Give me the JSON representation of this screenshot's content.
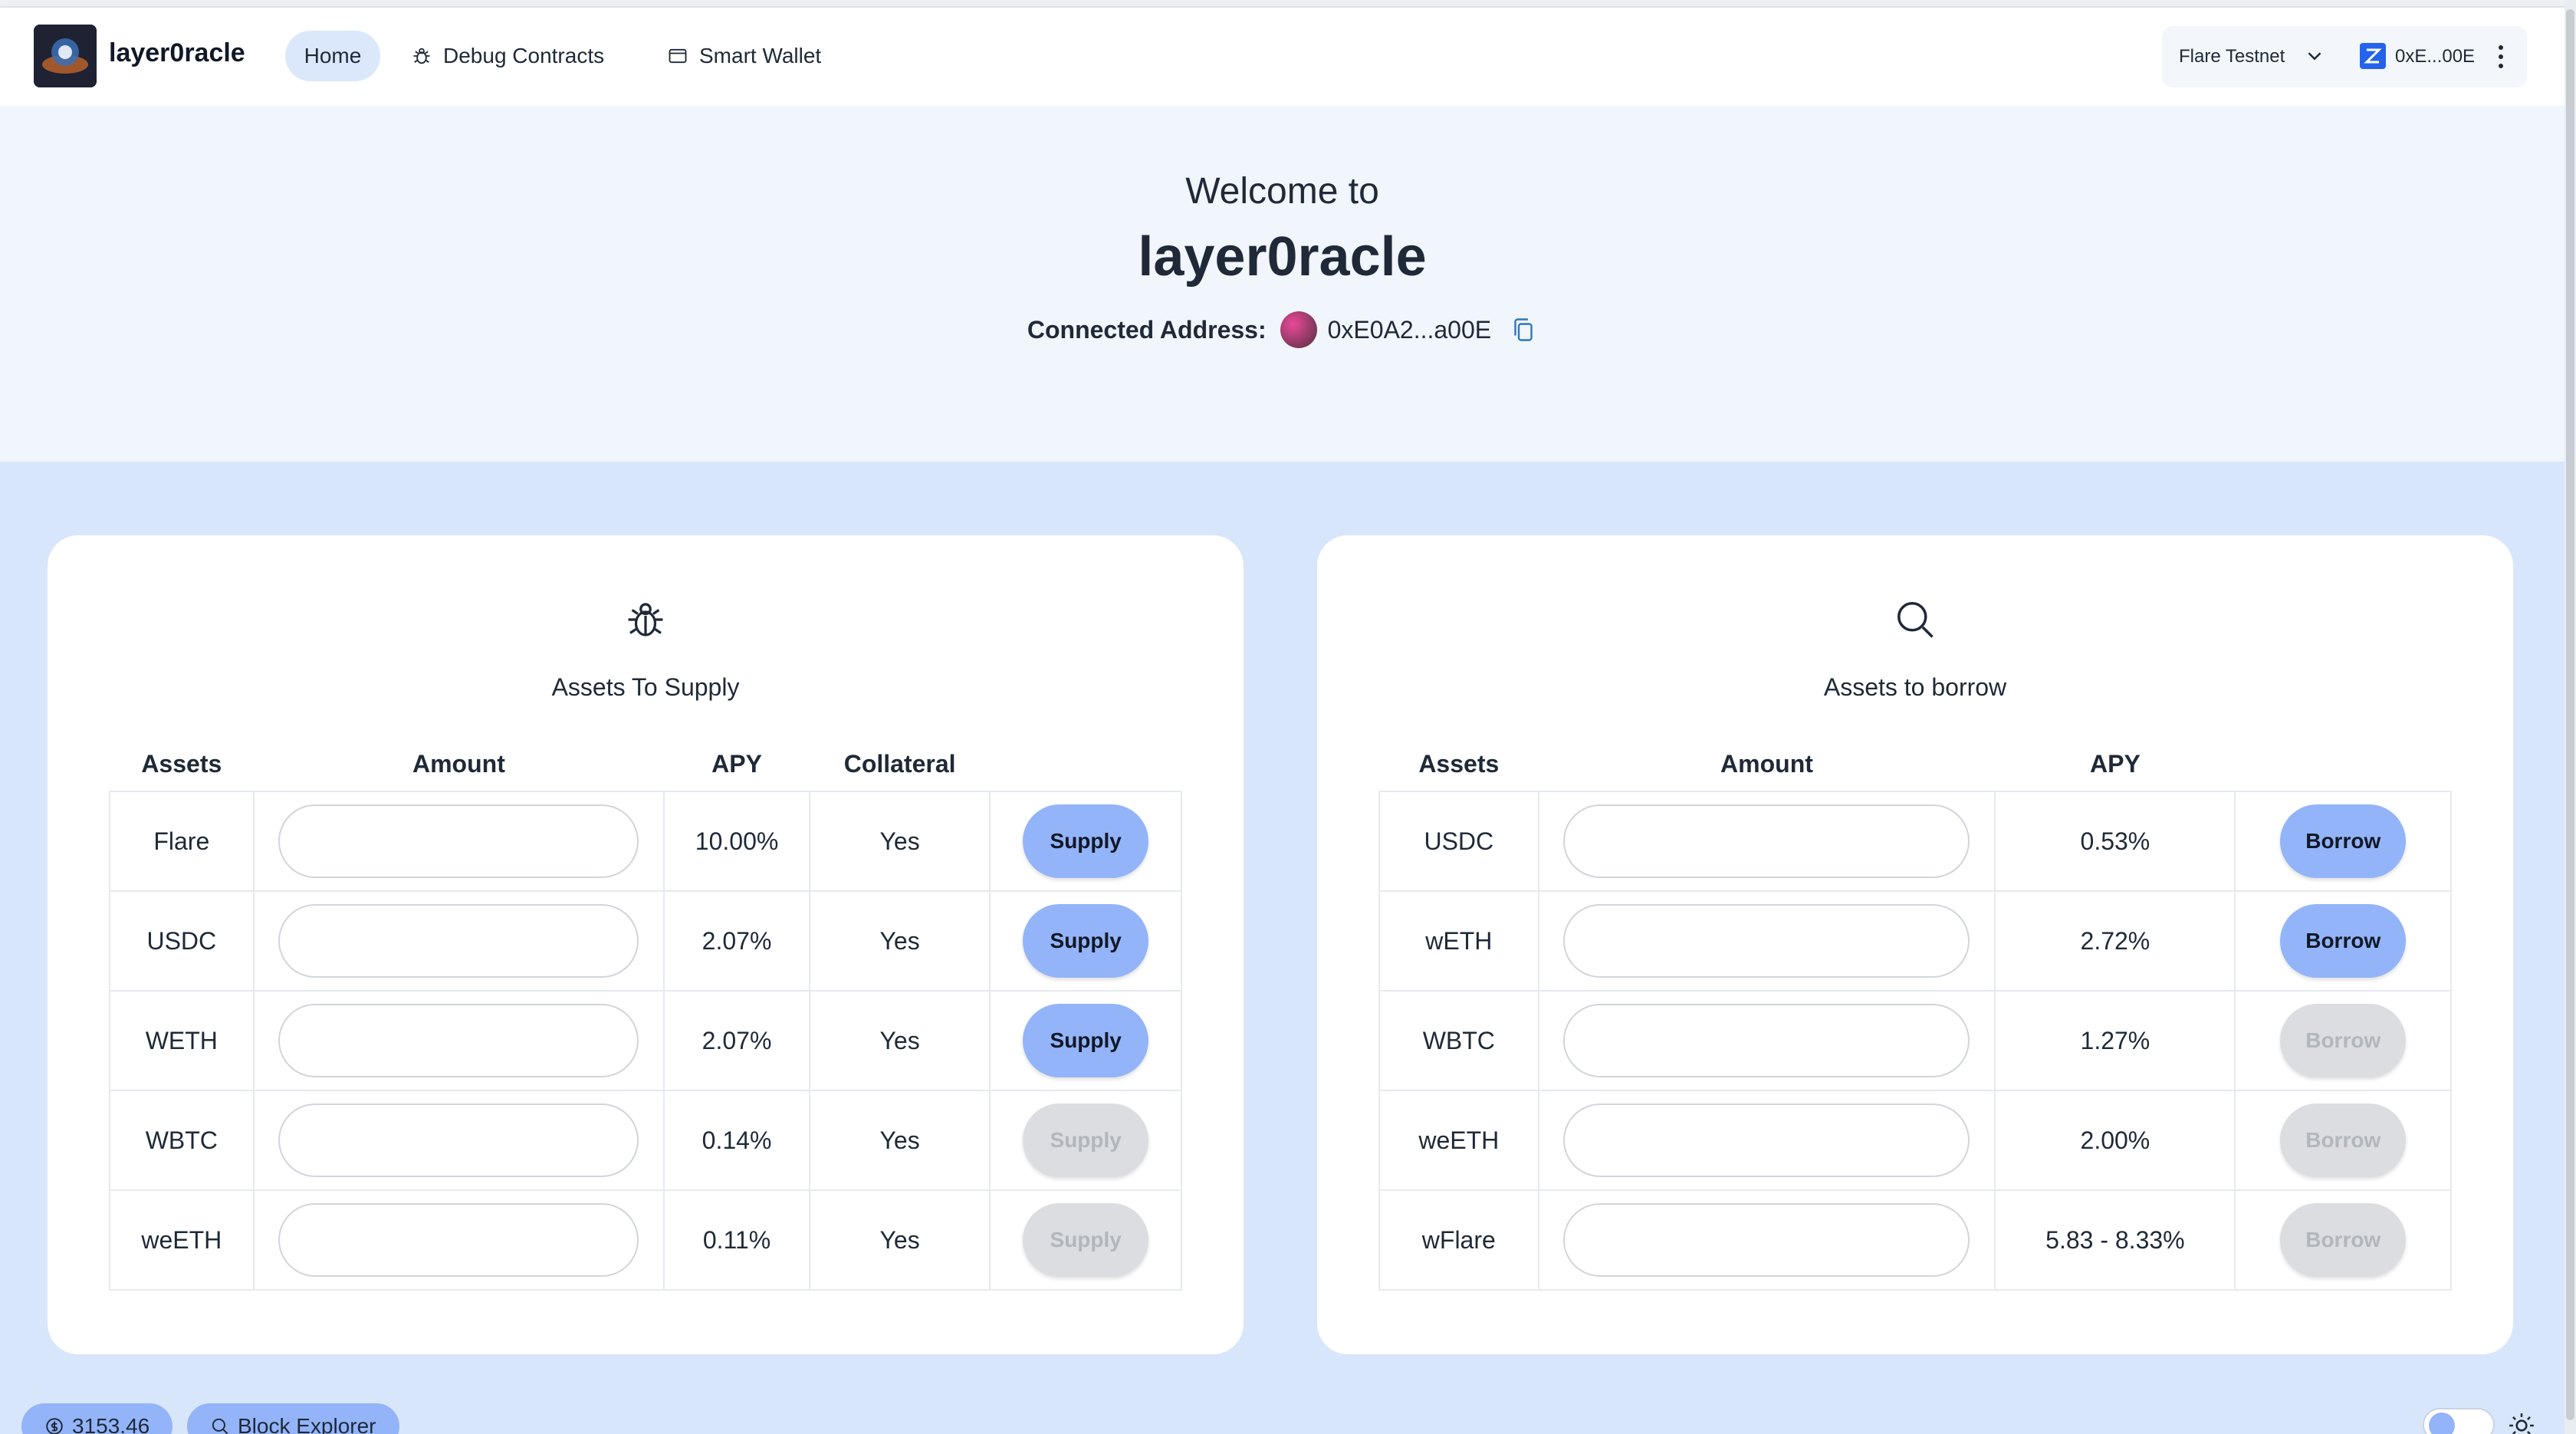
{
  "header": {
    "brand": "layer0racle",
    "nav": [
      {
        "label": "Home",
        "icon": "home"
      },
      {
        "label": "Debug Contracts",
        "icon": "bug-icon"
      },
      {
        "label": "Smart Wallet",
        "icon": "wallet-icon"
      }
    ],
    "network": "Flare Testnet",
    "wallet_short": "0xE...00E"
  },
  "hero": {
    "welcome": "Welcome to",
    "title": "layer0racle",
    "address_label": "Connected Address:",
    "address": "0xE0A2...a00E"
  },
  "supply": {
    "title": "Assets To Supply",
    "icon": "bug-icon",
    "columns": [
      "Assets",
      "Amount",
      "APY",
      "Collateral",
      ""
    ],
    "rows": [
      {
        "asset": "Flare",
        "apy": "10.00%",
        "collateral": "Yes",
        "action": "Supply",
        "enabled": true
      },
      {
        "asset": "USDC",
        "apy": "2.07%",
        "collateral": "Yes",
        "action": "Supply",
        "enabled": true
      },
      {
        "asset": "WETH",
        "apy": "2.07%",
        "collateral": "Yes",
        "action": "Supply",
        "enabled": true
      },
      {
        "asset": "WBTC",
        "apy": "0.14%",
        "collateral": "Yes",
        "action": "Supply",
        "enabled": false
      },
      {
        "asset": "weETH",
        "apy": "0.11%",
        "collateral": "Yes",
        "action": "Supply",
        "enabled": false
      }
    ]
  },
  "borrow": {
    "title": "Assets to borrow",
    "icon": "search-icon",
    "columns": [
      "Assets",
      "Amount",
      "APY",
      ""
    ],
    "rows": [
      {
        "asset": "USDC",
        "apy": "0.53%",
        "action": "Borrow",
        "enabled": true
      },
      {
        "asset": "wETH",
        "apy": "2.72%",
        "action": "Borrow",
        "enabled": true
      },
      {
        "asset": "WBTC",
        "apy": "1.27%",
        "action": "Borrow",
        "enabled": false
      },
      {
        "asset": "weETH",
        "apy": "2.00%",
        "action": "Borrow",
        "enabled": false
      },
      {
        "asset": "wFlare",
        "apy": "5.83 - 8.33%",
        "action": "Borrow",
        "enabled": false
      }
    ]
  },
  "footer": {
    "price": "3153.46",
    "block_explorer": "Block Explorer"
  },
  "colors": {
    "accent": "#93b4f8",
    "page_bg": "#d8e6fc",
    "hero_bg": "#f1f5fc",
    "disabled": "#dcdde0"
  }
}
